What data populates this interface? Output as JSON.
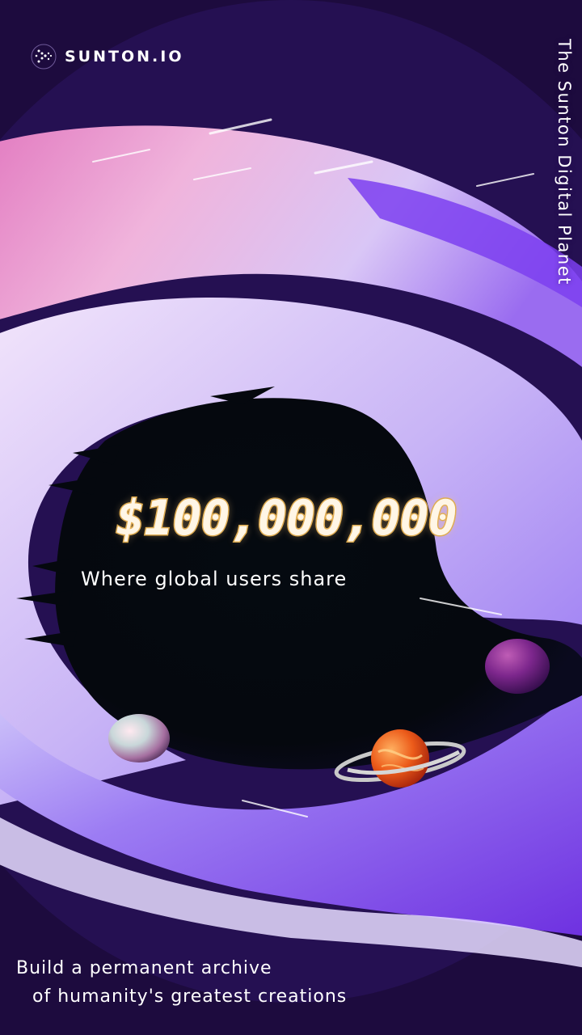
{
  "brand": {
    "name": "SUNTON.IO",
    "logo_icon": "sunton-logo-icon"
  },
  "tagline_vertical": "The Sunton Digital Planet",
  "hero": {
    "amount": "$100,000,000",
    "subtitle": "Where global users share"
  },
  "footer": {
    "line1": "Build a permanent archive",
    "line2": "of humanity's greatest creations"
  },
  "colors": {
    "background_dark": "#140828",
    "swirl_lavender": "#c9b3f5",
    "swirl_pink": "#e889c6",
    "swirl_violet": "#7a3cf0",
    "void": "#04070c",
    "amount_outline": "#d9a74a"
  },
  "decorations": {
    "planets": [
      "pearl-planet-icon",
      "ringed-orange-planet-icon",
      "purple-planet-icon"
    ]
  }
}
